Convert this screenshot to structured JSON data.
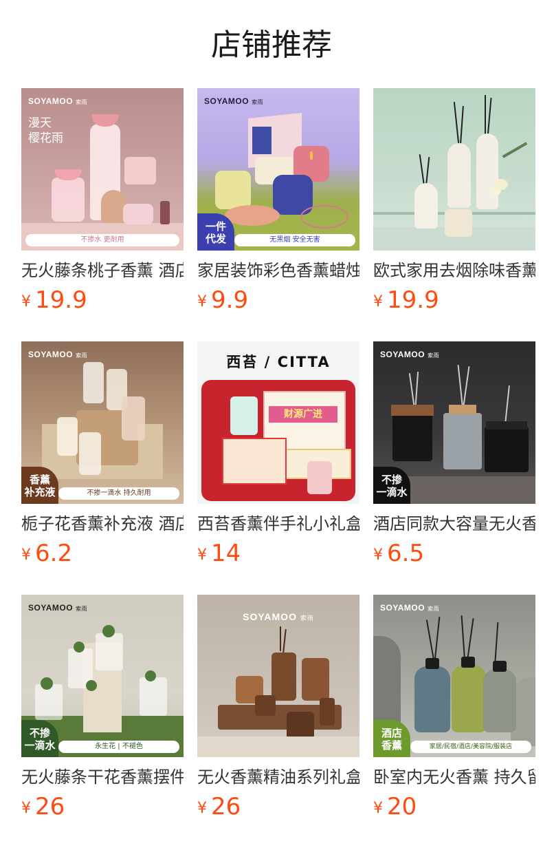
{
  "header": {
    "title": "店铺推荐"
  },
  "currency": "¥",
  "products": [
    {
      "name": "无火藤条桃子香薰 酒店同款",
      "price": "19.9",
      "image": {
        "brand": "SOYAMOO",
        "brand_sub": "索雨",
        "overlay_text": "漫天\n樱花雨",
        "strip_text": "不掺水 更耐用",
        "badge": ""
      }
    },
    {
      "name": "家居装饰彩色香薰蜡烛",
      "price": "9.9",
      "image": {
        "brand": "SOYAMOO",
        "brand_sub": "索雨",
        "overlay_text": "",
        "strip_text": "无黑烟 安全无害",
        "badge": "一件\n代发"
      }
    },
    {
      "name": "欧式家用去烟除味香薰",
      "price": "19.9",
      "image": {
        "brand": "",
        "brand_sub": "",
        "overlay_text": "",
        "strip_text": "",
        "badge": ""
      }
    },
    {
      "name": "栀子花香薰补充液 酒店同款",
      "price": "6.2",
      "image": {
        "brand": "SOYAMOO",
        "brand_sub": "索雨",
        "overlay_text": "",
        "strip_text": "不掺一滴水 持久耐用",
        "badge": "香薰\n补充液"
      }
    },
    {
      "name": "西苔香薰伴手礼小礼盒",
      "price": "14",
      "image": {
        "brand": "西苔 / CITTA",
        "brand_sub": "",
        "overlay_text": "财源广进",
        "strip_text": "",
        "badge": ""
      }
    },
    {
      "name": "酒店同款大容量无火香薰",
      "price": "6.5",
      "image": {
        "brand": "SOYAMOO",
        "brand_sub": "索雨",
        "overlay_text": "",
        "strip_text": "",
        "badge": "不掺\n一滴水"
      }
    },
    {
      "name": "无火藤条干花香薰摆件",
      "price": "26",
      "image": {
        "brand": "SOYAMOO",
        "brand_sub": "索雨",
        "overlay_text": "",
        "strip_text": "永生花 | 不褪色",
        "badge": "不掺\n一滴水"
      }
    },
    {
      "name": "无火香薰精油系列礼盒",
      "price": "26",
      "image": {
        "brand": "SOYAMOO",
        "brand_sub": "索雨",
        "overlay_text": "",
        "strip_text": "",
        "badge": ""
      }
    },
    {
      "name": "卧室内无火香薰 持久留香",
      "price": "20",
      "image": {
        "brand": "SOYAMOO",
        "brand_sub": "索雨",
        "overlay_text": "",
        "strip_text": "家居/民宿/酒店/美容院/服装店",
        "badge": "酒店\n香薰"
      }
    }
  ],
  "colors": {
    "price": "#ff4a10",
    "title": "#1a1a1a",
    "name": "#333333"
  }
}
